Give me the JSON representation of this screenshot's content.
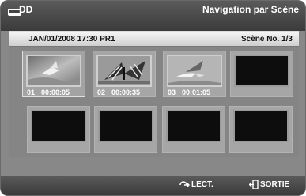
{
  "header": {
    "source": "DD",
    "disc_icon": "hdd-disc-icon",
    "title": "Navigation par Scène"
  },
  "info": {
    "datetime_program": "JAN/01/2008 17:30 PR1",
    "scene_counter": "Scène No. 1/3"
  },
  "scenes": [
    {
      "index": "01",
      "time": "00:00:05",
      "thumbnail": "seagull-on-water",
      "selected": true
    },
    {
      "index": "02",
      "time": "00:00:35",
      "thumbnail": "butterfly",
      "selected": false
    },
    {
      "index": "03",
      "time": "00:01:05",
      "thumbnail": "seagull-in-flight",
      "selected": false
    },
    {
      "empty": true
    },
    {
      "empty": true
    },
    {
      "empty": true
    },
    {
      "empty": true
    },
    {
      "empty": true
    }
  ],
  "footer": {
    "play_label": "LECT.",
    "play_icon": "enter-play-icon",
    "exit_label": "SORTIE",
    "exit_icon": "exit-door-icon"
  }
}
